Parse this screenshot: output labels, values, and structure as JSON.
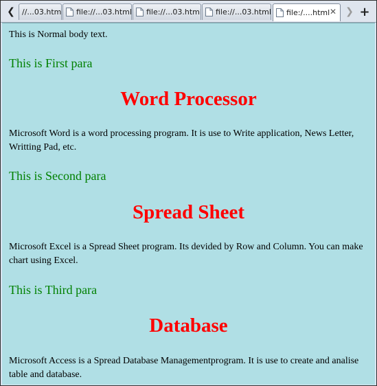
{
  "tabs": [
    {
      "label": "//...03.html",
      "active": false
    },
    {
      "label": "file://...03.html",
      "active": false
    },
    {
      "label": "file://...03.html",
      "active": false
    },
    {
      "label": "file://...03.html",
      "active": false
    },
    {
      "label": "file:/....html",
      "active": true
    }
  ],
  "nav": {
    "back_icon": "chevron-left-icon",
    "forward_icon": "chevron-right-icon",
    "new_tab_icon": "plus-icon",
    "close_icon": "close-icon"
  },
  "page": {
    "normal_text": "This is Normal body text.",
    "first_para": "This is First para",
    "heading1": "Word Processor",
    "text1": "Microsoft Word is a word processing program. It is use to Write application, News Letter, Writting Pad, etc.",
    "second_para": "This is Second para",
    "heading2": "Spread Sheet",
    "text2": "Microsoft Excel is a Spread Sheet program. Its devided by Row and Column.  You can make chart using Excel.",
    "third_para": "This is Third para",
    "heading3": "Database",
    "text3": "Microsoft Access is a Spread Database Managementprogram. It is use to create and analise table and database."
  },
  "colors": {
    "page_background": "#b0dfe5",
    "para_green": "#008000",
    "heading_red": "#ff0000"
  }
}
